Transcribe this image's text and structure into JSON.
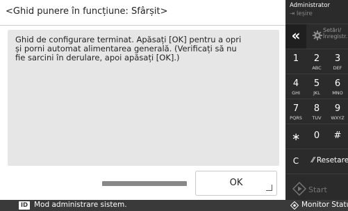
{
  "screen": {
    "title": "<Ghid punere în funcțiune: Sfârșit>",
    "message": "Ghid de configurare terminat. Apăsați [OK] pentru a opri și porni automat alimentarea generală. (Verificați să nu fie sarcini în derulare, apoi apăsați [OK].)",
    "ok_label": "OK"
  },
  "status_bar": {
    "id_badge": "ID",
    "mode_text": "Mod administrare sistem.",
    "monitor_label": "Monitor Statut",
    "monitor_icon": "eye-icon"
  },
  "panel": {
    "admin_name": "Administrator",
    "logout_label": "Ieșire",
    "back_icon": "double-chevron-left-icon",
    "settings_label": "Setări/ Înregistr.",
    "settings_icon": "gear-icon",
    "keys": [
      {
        "digit": "1",
        "letters": ""
      },
      {
        "digit": "2",
        "letters": "ABC"
      },
      {
        "digit": "3",
        "letters": "DEF"
      },
      {
        "digit": "4",
        "letters": "GHI"
      },
      {
        "digit": "5",
        "letters": "JKL"
      },
      {
        "digit": "6",
        "letters": "MNO"
      },
      {
        "digit": "7",
        "letters": "PQRS"
      },
      {
        "digit": "8",
        "letters": "TUV"
      },
      {
        "digit": "9",
        "letters": "WXYZ"
      },
      {
        "digit": "∗",
        "letters": ""
      },
      {
        "digit": "0",
        "letters": ""
      },
      {
        "digit": "#",
        "letters": ""
      }
    ],
    "clear_label": "C",
    "reset_label": "⁄⁄ Resetare",
    "start_label": "Start",
    "start_icon": "diamond-play-icon"
  },
  "colors": {
    "panel_bg": "#2b2b2b",
    "status_bg": "#3a3a3a",
    "message_bg": "#e6e6e6"
  }
}
